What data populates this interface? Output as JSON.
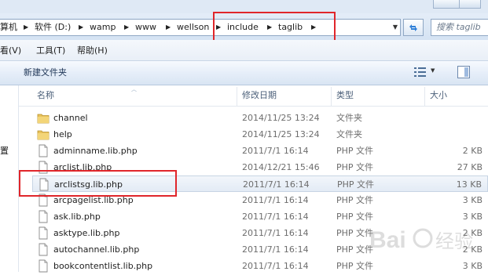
{
  "address_bar": {
    "crumbs": [
      "算机",
      "软件 (D:)",
      "wamp",
      "www",
      "wellson",
      "include",
      "taglib"
    ],
    "search_placeholder": "搜索 taglib"
  },
  "menu": [
    "看(V)",
    "工具(T)",
    "帮助(H)"
  ],
  "toolbar": {
    "new_folder": "新建文件夹"
  },
  "nav_pane": {
    "partial_label": "置"
  },
  "columns": {
    "name": "名称",
    "date": "修改日期",
    "type": "类型",
    "size": "大小"
  },
  "files": [
    {
      "icon": "folder-icon",
      "name": "channel",
      "date": "2014/11/25 13:24",
      "type": "文件夹",
      "size": ""
    },
    {
      "icon": "folder-icon",
      "name": "help",
      "date": "2014/11/25 13:24",
      "type": "文件夹",
      "size": ""
    },
    {
      "icon": "file-icon",
      "name": "adminname.lib.php",
      "date": "2011/7/1 16:14",
      "type": "PHP 文件",
      "size": "2 KB"
    },
    {
      "icon": "file-icon",
      "name": "arclist.lib.php",
      "date": "2014/12/21 15:46",
      "type": "PHP 文件",
      "size": "27 KB"
    },
    {
      "icon": "file-icon",
      "name": "arclistsg.lib.php",
      "date": "2011/7/1 16:14",
      "type": "PHP 文件",
      "size": "13 KB"
    },
    {
      "icon": "file-icon",
      "name": "arcpagelist.lib.php",
      "date": "2011/7/1 16:14",
      "type": "PHP 文件",
      "size": "3 KB"
    },
    {
      "icon": "file-icon",
      "name": "ask.lib.php",
      "date": "2011/7/1 16:14",
      "type": "PHP 文件",
      "size": "3 KB"
    },
    {
      "icon": "file-icon",
      "name": "asktype.lib.php",
      "date": "2011/7/1 16:14",
      "type": "PHP 文件",
      "size": "2 KB"
    },
    {
      "icon": "file-icon",
      "name": "autochannel.lib.php",
      "date": "2011/7/1 16:14",
      "type": "PHP 文件",
      "size": "2 KB"
    },
    {
      "icon": "file-icon",
      "name": "bookcontentlist.lib.php",
      "date": "2011/7/1 16:14",
      "type": "PHP 文件",
      "size": "3 KB"
    }
  ],
  "selected_index": 4,
  "colors": {
    "highlight_red": "#e0262b",
    "folder": "#e8c25c",
    "chrome": "#dfe9f5"
  },
  "watermark": "Bai百度 经验"
}
